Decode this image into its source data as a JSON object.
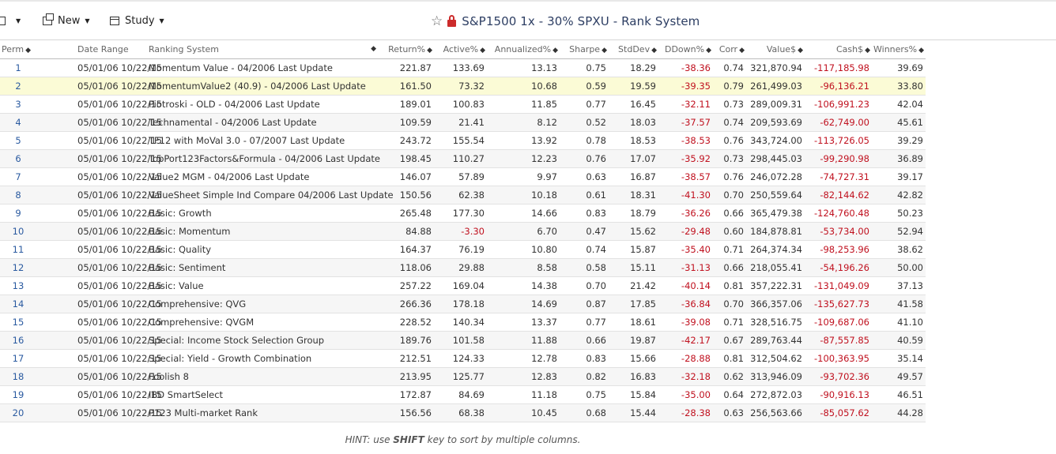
{
  "toolbar": {
    "new_label": "New",
    "study_label": "Study"
  },
  "title": "S&P1500 1x - 30% SPXU - Rank System",
  "colors": {
    "negative": "#c0111f",
    "title": "#2d3e63",
    "selected_row": "#fbfbd6",
    "lock": "#cc2b2b"
  },
  "table": {
    "headers": [
      "Perm",
      "Date Range",
      "Ranking System",
      "Return%",
      "Active%",
      "Annualized%",
      "Sharpe",
      "StdDev",
      "DDown%",
      "Corr",
      "Value$",
      "Cash$",
      "Winners%"
    ],
    "rows": [
      [
        "1",
        "05/01/06 10/22/15",
        "Momentum Value - 04/2006 Last Update",
        "221.87",
        "133.69",
        "13.13",
        "0.75",
        "18.29",
        "-38.36",
        "0.74",
        "321,870.94",
        "-117,185.98",
        "39.69"
      ],
      [
        "2",
        "05/01/06 10/22/15",
        "MomentumValue2 (40.9) - 04/2006 Last Update",
        "161.50",
        "73.32",
        "10.68",
        "0.59",
        "19.59",
        "-39.35",
        "0.79",
        "261,499.03",
        "-96,136.21",
        "33.80"
      ],
      [
        "3",
        "05/01/06 10/22/15",
        "Piotroski - OLD - 04/2006 Last Update",
        "189.01",
        "100.83",
        "11.85",
        "0.77",
        "16.45",
        "-32.11",
        "0.73",
        "289,009.31",
        "-106,991.23",
        "42.04"
      ],
      [
        "4",
        "05/01/06 10/22/15",
        "Technamental - 04/2006 Last Update",
        "109.59",
        "21.41",
        "8.12",
        "0.52",
        "18.03",
        "-37.57",
        "0.74",
        "209,593.69",
        "-62,749.00",
        "45.61"
      ],
      [
        "5",
        "05/01/06 10/22/15",
        "TF12 with MoVal 3.0 - 07/2007 Last Update",
        "243.72",
        "155.54",
        "13.92",
        "0.78",
        "18.53",
        "-38.53",
        "0.76",
        "343,724.00",
        "-113,726.05",
        "39.29"
      ],
      [
        "6",
        "05/01/06 10/22/15",
        "TopPort123Factors&Formula - 04/2006 Last Update",
        "198.45",
        "110.27",
        "12.23",
        "0.76",
        "17.07",
        "-35.92",
        "0.73",
        "298,445.03",
        "-99,290.98",
        "36.89"
      ],
      [
        "7",
        "05/01/06 10/22/15",
        "Value2 MGM - 04/2006 Last Update",
        "146.07",
        "57.89",
        "9.97",
        "0.63",
        "16.87",
        "-38.57",
        "0.76",
        "246,072.28",
        "-74,727.31",
        "39.17"
      ],
      [
        "8",
        "05/01/06 10/22/15",
        "ValueSheet Simple Ind Compare 04/2006 Last Update",
        "150.56",
        "62.38",
        "10.18",
        "0.61",
        "18.31",
        "-41.30",
        "0.70",
        "250,559.64",
        "-82,144.62",
        "42.82"
      ],
      [
        "9",
        "05/01/06 10/22/15",
        "Basic: Growth",
        "265.48",
        "177.30",
        "14.66",
        "0.83",
        "18.79",
        "-36.26",
        "0.66",
        "365,479.38",
        "-124,760.48",
        "50.23"
      ],
      [
        "10",
        "05/01/06 10/22/15",
        "Basic: Momentum",
        "84.88",
        "-3.30",
        "6.70",
        "0.47",
        "15.62",
        "-29.48",
        "0.60",
        "184,878.81",
        "-53,734.00",
        "52.94"
      ],
      [
        "11",
        "05/01/06 10/22/15",
        "Basic: Quality",
        "164.37",
        "76.19",
        "10.80",
        "0.74",
        "15.87",
        "-35.40",
        "0.71",
        "264,374.34",
        "-98,253.96",
        "38.62"
      ],
      [
        "12",
        "05/01/06 10/22/15",
        "Basic: Sentiment",
        "118.06",
        "29.88",
        "8.58",
        "0.58",
        "15.11",
        "-31.13",
        "0.66",
        "218,055.41",
        "-54,196.26",
        "50.00"
      ],
      [
        "13",
        "05/01/06 10/22/15",
        "Basic: Value",
        "257.22",
        "169.04",
        "14.38",
        "0.70",
        "21.42",
        "-40.14",
        "0.81",
        "357,222.31",
        "-131,049.09",
        "37.13"
      ],
      [
        "14",
        "05/01/06 10/22/15",
        "Comprehensive: QVG",
        "266.36",
        "178.18",
        "14.69",
        "0.87",
        "17.85",
        "-36.84",
        "0.70",
        "366,357.06",
        "-135,627.73",
        "41.58"
      ],
      [
        "15",
        "05/01/06 10/22/15",
        "Comprehensive: QVGM",
        "228.52",
        "140.34",
        "13.37",
        "0.77",
        "18.61",
        "-39.08",
        "0.71",
        "328,516.75",
        "-109,687.06",
        "41.10"
      ],
      [
        "16",
        "05/01/06 10/22/15",
        "Special: Income Stock Selection Group",
        "189.76",
        "101.58",
        "11.88",
        "0.66",
        "19.87",
        "-42.17",
        "0.67",
        "289,763.44",
        "-87,557.85",
        "40.59"
      ],
      [
        "17",
        "05/01/06 10/22/15",
        "Special: Yield - Growth Combination",
        "212.51",
        "124.33",
        "12.78",
        "0.83",
        "15.66",
        "-28.88",
        "0.81",
        "312,504.62",
        "-100,363.95",
        "35.14"
      ],
      [
        "18",
        "05/01/06 10/22/15",
        "Foolish 8",
        "213.95",
        "125.77",
        "12.83",
        "0.82",
        "16.83",
        "-32.18",
        "0.62",
        "313,946.09",
        "-93,702.36",
        "49.57"
      ],
      [
        "19",
        "05/01/06 10/22/15",
        "IBD SmartSelect",
        "172.87",
        "84.69",
        "11.18",
        "0.75",
        "15.84",
        "-35.00",
        "0.64",
        "272,872.03",
        "-90,916.13",
        "46.51"
      ],
      [
        "20",
        "05/01/06 10/22/15",
        "P123 Multi-market Rank",
        "156.56",
        "68.38",
        "10.45",
        "0.68",
        "15.44",
        "-28.38",
        "0.63",
        "256,563.66",
        "-85,057.62",
        "44.28"
      ]
    ]
  },
  "hint": {
    "prefix": "HINT: use ",
    "key": "SHIFT",
    "suffix": " key to sort by multiple columns."
  }
}
